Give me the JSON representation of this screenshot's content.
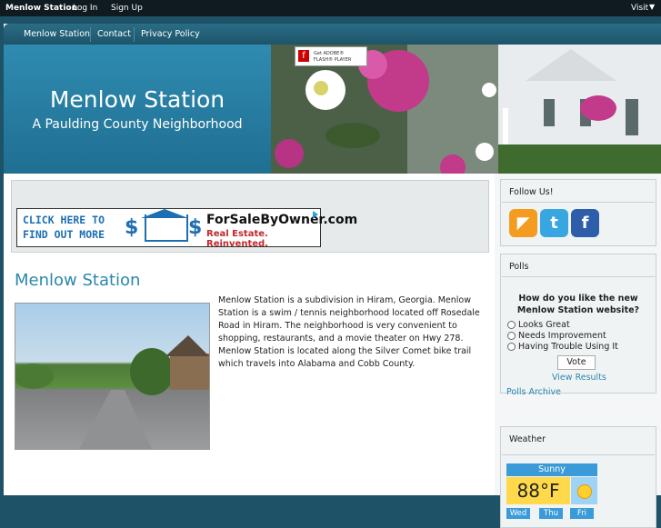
{
  "topbar": {
    "site": "Menlow Station",
    "login": "Log In",
    "signup": "Sign Up",
    "visit": "Visit"
  },
  "nav": {
    "items": [
      "Menlow Station",
      "Contact",
      "Privacy Policy"
    ]
  },
  "header": {
    "title": "Menlow Station",
    "subtitle": "A Paulding County Neighborhood",
    "flash": {
      "line1": "Get ADOBE®",
      "line2": "FLASH® PLAYER",
      "icon": "f"
    }
  },
  "ad": {
    "line1": "CLICK HERE TO",
    "line2": "FIND OUT MORE",
    "brand": "ForSaleByOwner.com",
    "tagline": "Real Estate. Reinvented.",
    "dollar": "$"
  },
  "main": {
    "title": "Menlow Station",
    "description": "Menlow Station is a subdivision in Hiram, Georgia.  Menlow Station is a swim / tennis neighborhood located off Rosedale Road in Hiram.  The neighborhood is very convenient to shopping, restaurants, and a movie theater on Hwy 278.  Menlow Station is located along the Silver Comet bike trail which travels into Alabama and Cobb County."
  },
  "follow": {
    "title": "Follow Us!",
    "icons": [
      "rss-icon",
      "twitter-icon",
      "facebook-icon"
    ],
    "glyphs": [
      "◤",
      "t",
      "f"
    ],
    "colors": [
      "#f39c1f",
      "#38a6e0",
      "#2e5ea9"
    ]
  },
  "polls": {
    "title": "Polls",
    "question": "How do you like the new Menlow Station website?",
    "options": [
      "Looks Great",
      "Needs Improvement",
      "Having Trouble Using It"
    ],
    "vote": "Vote",
    "view_results": "View Results",
    "archive": "Polls Archive"
  },
  "weather": {
    "title": "Weather",
    "condition": "Sunny",
    "temp": "88°F",
    "days": [
      "Wed",
      "Thu",
      "Fri"
    ]
  },
  "colors": {
    "accent": "#2a87ae",
    "nav": "#1e5266"
  }
}
